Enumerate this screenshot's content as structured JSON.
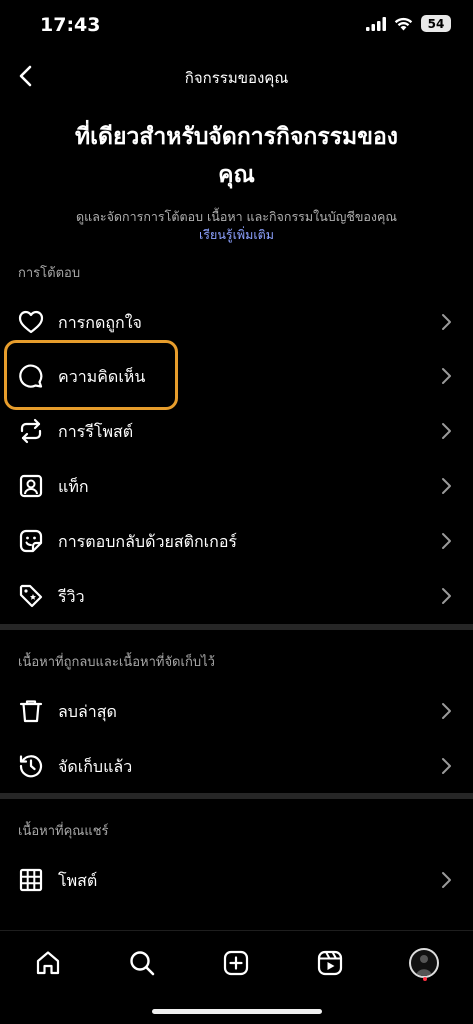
{
  "status_bar": {
    "time": "17:43",
    "battery": "54"
  },
  "header": {
    "title": "กิจกรรมของคุณ"
  },
  "hero": {
    "title": "ที่เดียวสำหรับจัดการกิจกรรมของคุณ",
    "description": "ดูและจัดการการโต้ตอบ เนื้อหา และกิจกรรมในบัญชีของคุณ",
    "link": "เรียนรู้เพิ่มเติม"
  },
  "interactions": {
    "header": "การโต้ตอบ",
    "items": [
      {
        "label": "การกดถูกใจ",
        "icon": "heart-icon"
      },
      {
        "label": "ความคิดเห็น",
        "icon": "comment-icon"
      },
      {
        "label": "การรีโพสต์",
        "icon": "repost-icon"
      },
      {
        "label": "แท็ก",
        "icon": "tag-person-icon"
      },
      {
        "label": "การตอบกลับด้วยสติกเกอร์",
        "icon": "sticker-icon"
      },
      {
        "label": "รีวิว",
        "icon": "review-tag-icon"
      }
    ]
  },
  "removed": {
    "header": "เนื้อหาที่ถูกลบและเนื้อหาที่จัดเก็บไว้",
    "items": [
      {
        "label": "ลบล่าสุด",
        "icon": "trash-icon"
      },
      {
        "label": "จัดเก็บแล้ว",
        "icon": "archive-history-icon"
      }
    ]
  },
  "shared": {
    "header": "เนื้อหาที่คุณแชร์",
    "items": [
      {
        "label": "โพสต์",
        "icon": "grid-icon"
      }
    ]
  },
  "bottom_nav": [
    "home-icon",
    "search-icon",
    "create-icon",
    "reels-icon",
    "profile-avatar"
  ],
  "colors": {
    "background": "#000000",
    "link": "#8da2ff",
    "highlight": "#e79d2c",
    "divider": "#262626"
  }
}
